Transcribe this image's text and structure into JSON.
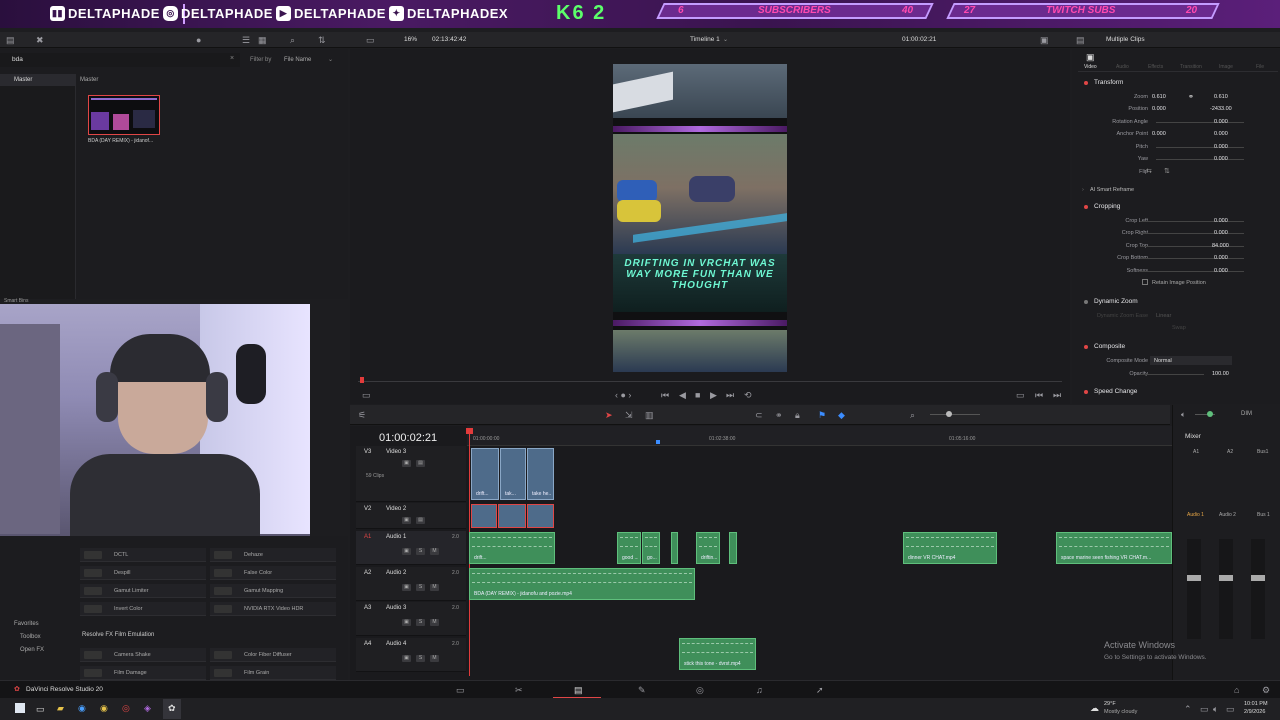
{
  "banner": {
    "twitch_handle": "DELTAPHADE",
    "instagram_handle": "DELTAPHADE",
    "youtube_handle": "DELTAPHADE",
    "twitter_handle": "DELTAPHADEX",
    "logo_text": "K6 2",
    "subs_current": "6",
    "subs_label": "SUBSCRIBERS",
    "subs_goal": "40",
    "twitch_current": "27",
    "twitch_label": "TWITCH SUBS",
    "twitch_goal": "20"
  },
  "media_pool": {
    "search_value": "bda",
    "filter_by_label": "Filter by",
    "filter_value": "File Name",
    "bin_label": "Master",
    "bin_header": "Master",
    "clip_name": "BDA (DAY REMIX) - jidanof...",
    "smart_bins_label": "Smart Bins"
  },
  "viewer": {
    "zoom": "16%",
    "timecode_duration": "02:13:42:42",
    "timeline_name": "Timeline 1",
    "current_timecode": "01:00:02:21",
    "overlay_text": "DRIFTING IN VRCHAT WAS WAY MORE FUN THAN WE THOUGHT"
  },
  "inspector": {
    "title": "Multiple Clips",
    "tabs": [
      "Video",
      "Audio",
      "Effects",
      "Transition",
      "Image",
      "File"
    ],
    "transform_label": "Transform",
    "zoom_label": "Zoom",
    "zoom_x": "0.610",
    "zoom_y": "0.610",
    "position_label": "Position",
    "position_x": "0.000",
    "position_y": "-2433.00",
    "rotation_label": "Rotation Angle",
    "rotation_val": "0.000",
    "anchor_label": "Anchor Point",
    "anchor_x": "0.000",
    "anchor_y": "0.000",
    "pitch_label": "Pitch",
    "pitch_val": "0.000",
    "yaw_label": "Yaw",
    "yaw_val": "0.000",
    "flip_label": "Flip",
    "smart_reframe_label": "AI Smart Reframe",
    "cropping_label": "Cropping",
    "crop_left_label": "Crop Left",
    "crop_left_val": "0.000",
    "crop_right_label": "Crop Right",
    "crop_right_val": "0.000",
    "crop_top_label": "Crop Top",
    "crop_top_val": "84.000",
    "crop_bottom_label": "Crop Bottom",
    "crop_bottom_val": "0.000",
    "softness_label": "Softness",
    "softness_val": "0.000",
    "retain_label": "Retain Image Position",
    "dynamic_zoom_label": "Dynamic Zoom",
    "dz_ease_label": "Dynamic Zoom Ease",
    "dz_ease_val": "Linear",
    "swap_label": "Swap",
    "composite_label": "Composite",
    "composite_mode_label": "Composite Mode",
    "composite_mode_val": "Normal",
    "opacity_label": "Opacity",
    "opacity_val": "100.00",
    "speed_change_label": "Speed Change"
  },
  "timeline": {
    "timecode": "01:00:02:21",
    "ruler": [
      "01:00:00:00",
      "01:02:38:00",
      "01:05:16:00"
    ],
    "tracks": [
      {
        "id": "V3",
        "name": "Video 3",
        "extra": "59 Clips"
      },
      {
        "id": "V2",
        "name": "Video 2",
        "extra": ""
      },
      {
        "id": "A1",
        "name": "Audio 1",
        "extra": "2.0"
      },
      {
        "id": "A2",
        "name": "Audio 2",
        "extra": "2.0"
      },
      {
        "id": "A3",
        "name": "Audio 3",
        "extra": "2.0"
      },
      {
        "id": "A4",
        "name": "Audio 4",
        "extra": "2.0"
      }
    ],
    "clip_labels": {
      "v3_a": "drift...",
      "v3_b": "tak...",
      "v3_c": "take he...",
      "a1_a": "drift...",
      "a1_b": "good ...",
      "a1_c": "go...",
      "a1_d": "driftin...",
      "a1_e": "dinner VR CHAT.mp4",
      "a1_f": "space marine seen fishing VR CHAT.m...",
      "a2": "BDA (DAY REMIX) - jidanofu and pozie.mp4",
      "a4": "stick this tone - dvrst.mp4"
    }
  },
  "effects": {
    "items_left": [
      "DCTL",
      "Despill",
      "Gamut Limiter",
      "Invert Color"
    ],
    "items_right": [
      "Dehaze",
      "False Color",
      "Gamut Mapping",
      "NVIDIA RTX Video HDR"
    ],
    "film_emulation_label": "Resolve FX Film Emulation",
    "film_left": [
      "Camera Shake",
      "Film Damage"
    ],
    "film_right": [
      "Color Fiber Diffuser",
      "Film Grain"
    ],
    "favorites_label": "Favorites",
    "toolbox_label": "Toolbox",
    "openfx_label": "Open FX"
  },
  "mixer": {
    "title": "Mixer",
    "dim_label": "DIM",
    "channels": [
      "A1",
      "A2",
      "Bus1"
    ],
    "channel_names": [
      "Audio 1",
      "Audio 2",
      "Bus 1"
    ]
  },
  "watermark": {
    "line1": "Activate Windows",
    "line2": "Go to Settings to activate Windows."
  },
  "app": {
    "name": "DaVinci Resolve Studio 20"
  },
  "taskbar": {
    "weather_temp": "29°F",
    "weather_desc": "Mostly cloudy",
    "time": "10:01 PM",
    "date": "2/9/2026"
  },
  "colors": {
    "accent": "#e04646",
    "clip_green": "#3f8f5a",
    "clip_blue": "#4e6b8a",
    "playhead": "#e23b3b",
    "neon_text": "#6ef7d2"
  }
}
